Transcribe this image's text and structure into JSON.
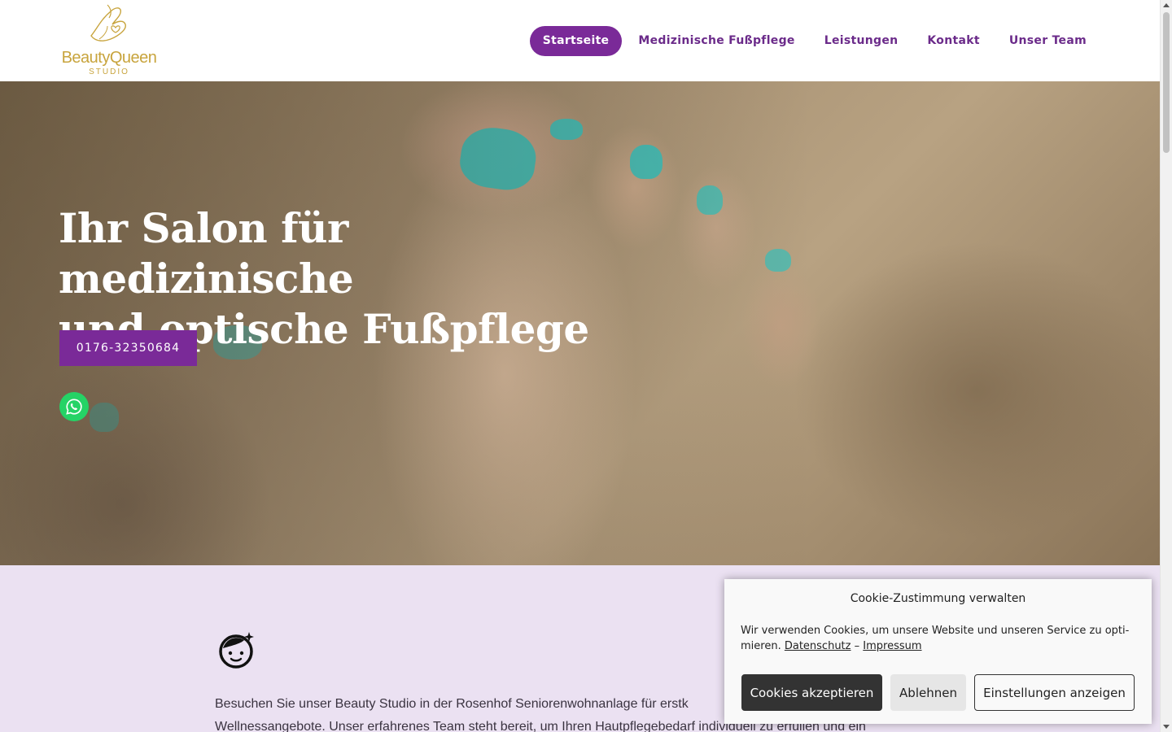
{
  "logo": {
    "brand": "BeautyQueen",
    "sub": "STUDIO",
    "icon": "hand-feet-logo"
  },
  "nav": {
    "items": [
      {
        "label": "Startseite",
        "active": true
      },
      {
        "label": "Medizinische Fußpflege",
        "active": false
      },
      {
        "label": "Leistungen",
        "active": false
      },
      {
        "label": "Kontakt",
        "active": false
      },
      {
        "label": "Unser Team",
        "active": false
      }
    ]
  },
  "hero": {
    "title_line1": "Ihr Salon für medizinische",
    "title_line2": "und optische Fußpflege",
    "phone_label": "0176-32350684",
    "whatsapp_icon": "whatsapp-icon"
  },
  "content": {
    "icon": "smiling-face-sparkle-icon",
    "intro_line1": "Besuchen Sie unser Beauty Studio in der Rosenhof Seniorenwohnanlage für erstk",
    "intro_line2": "Wellnessangebote. Unser erfahrenes Team steht bereit, um Ihren Hautpflegebedarf individuell zu erfüllen und ein"
  },
  "cookie": {
    "title": "Cookie-Zustimmung verwalten",
    "text_line1": "Wir verwenden Cookies, um unsere Website und unseren Service zu opti-",
    "text_line2": "mieren.",
    "link_privacy": "Datenschutz",
    "separator": "–",
    "link_imprint": "Impressum",
    "accept_label": "Cookies akzeptieren",
    "deny_label": "Ablehnen",
    "settings_label": "Einstellungen anzeigen"
  },
  "colors": {
    "accent": "#7a2a98",
    "nav_text": "#6b2b8a",
    "logo_gold": "#c8a43d",
    "content_bg": "#ebe1f2",
    "whatsapp": "#25d366"
  }
}
